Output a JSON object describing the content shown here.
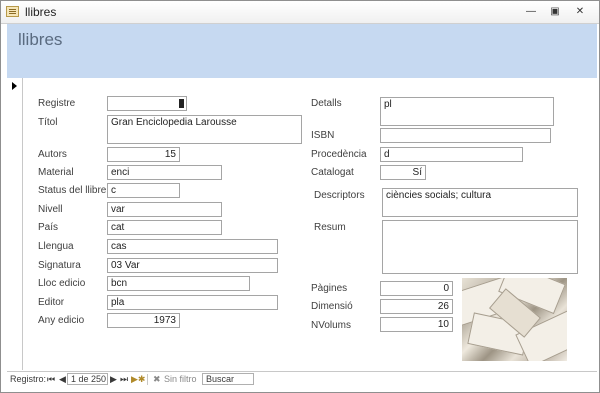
{
  "window": {
    "title": "llibres",
    "min_icon": "minimize-icon",
    "max_icon": "restore-icon",
    "close_icon": "close-icon"
  },
  "form": {
    "title": "llibres"
  },
  "fields": {
    "registre": {
      "label": "Registre",
      "value": ""
    },
    "titol": {
      "label": "Títol",
      "value": "Gran Enciclopedia Larousse"
    },
    "autors": {
      "label": "Autors",
      "value": "15"
    },
    "material": {
      "label": "Material",
      "value": "enci"
    },
    "status": {
      "label": "Status del llibre",
      "value": "c"
    },
    "nivell": {
      "label": "Nivell",
      "value": "var"
    },
    "pais": {
      "label": "País",
      "value": "cat"
    },
    "llengua": {
      "label": "Llengua",
      "value": "cas"
    },
    "signatura": {
      "label": "Signatura",
      "value": "03 Var"
    },
    "lloc": {
      "label": "Lloc edicio",
      "value": "bcn"
    },
    "editor": {
      "label": "Editor",
      "value": "pla"
    },
    "any": {
      "label": "Any edicio",
      "value": "1973"
    },
    "detalls": {
      "label": "Detalls",
      "value": "pl"
    },
    "isbn": {
      "label": "ISBN",
      "value": ""
    },
    "procedencia": {
      "label": "Procedència",
      "value": "d"
    },
    "catalogat": {
      "label": "Catalogat",
      "value": "Sí"
    },
    "descriptors": {
      "label": "Descriptors",
      "value": "ciències socials; cultura"
    },
    "resum": {
      "label": "Resum",
      "value": ""
    },
    "pagines": {
      "label": "Pàgines",
      "value": "0"
    },
    "dimensio": {
      "label": "Dimensió",
      "value": "26"
    },
    "nvolums": {
      "label": "NVolums",
      "value": "10"
    }
  },
  "nav": {
    "label": "Registro:",
    "position": "1 de 250",
    "filter": "Sin filtro",
    "search": "Buscar",
    "first": "⏮",
    "prev": "◀",
    "next": "▶",
    "last": "⏭",
    "new": "▶✱"
  }
}
